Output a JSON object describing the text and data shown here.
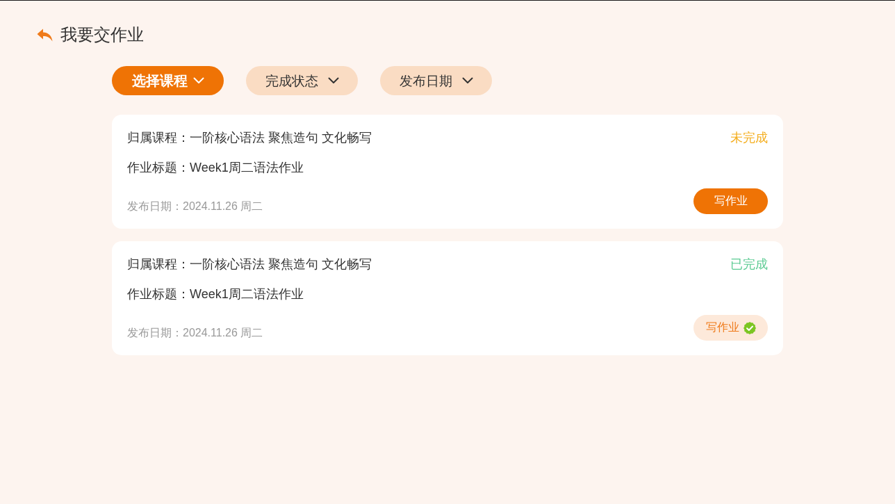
{
  "header": {
    "title": "我要交作业"
  },
  "filters": [
    {
      "label": "选择课程",
      "selected": true
    },
    {
      "label": "完成状态",
      "selected": false
    },
    {
      "label": "发布日期",
      "selected": false
    }
  ],
  "assignments": [
    {
      "course": "归属课程：一阶核心语法 聚焦造句 文化畅写",
      "title": "作业标题：Week1周二语法作业",
      "date": "发布日期：2024.11.26 周二",
      "status": "未完成",
      "completed": false,
      "button": "写作业"
    },
    {
      "course": "归属课程：一阶核心语法 聚焦造句 文化畅写",
      "title": "作业标题：Week1周二语法作业",
      "date": "发布日期：2024.11.26 周二",
      "status": "已完成",
      "completed": true,
      "button": "写作业"
    }
  ]
}
